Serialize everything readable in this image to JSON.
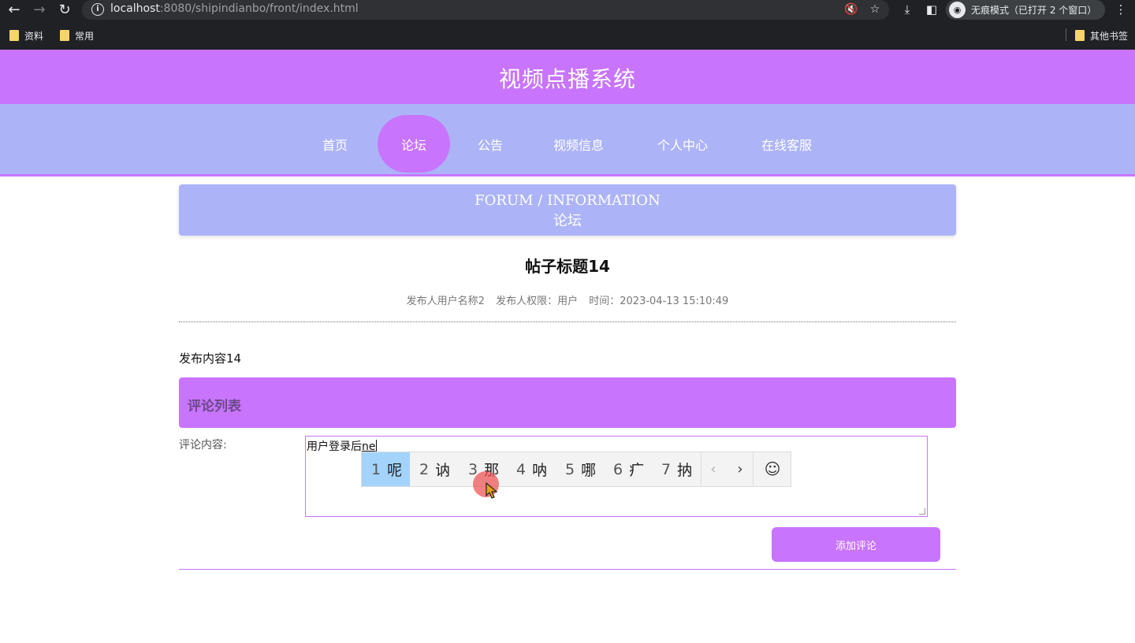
{
  "browser": {
    "url_host": "localhost",
    "url_rest": ":8080/shipindianbo/front/index.html",
    "incognito_label": "无痕模式（已打开 2 个窗口）",
    "bookmarks": [
      "资料",
      "常用"
    ],
    "other_bookmarks": "其他书签"
  },
  "site": {
    "title": "视频点播系统",
    "nav": [
      {
        "label": "首页"
      },
      {
        "label": "论坛",
        "active": true
      },
      {
        "label": "公告"
      },
      {
        "label": "视频信息"
      },
      {
        "label": "个人中心"
      },
      {
        "label": "在线客服"
      }
    ]
  },
  "banner": {
    "en": "FORUM / INFORMATION",
    "cn": "论坛"
  },
  "post": {
    "title": "帖子标题14",
    "author": "发布人用户名称2",
    "role": "发布人权限：用户",
    "time": "时间：2023-04-13 15:10:49",
    "content": "发布内容14"
  },
  "comments": {
    "header": "评论列表",
    "label": "评论内容:",
    "input_committed": "用户登录后",
    "input_preedit": "ne",
    "submit": "添加评论"
  },
  "ime": {
    "candidates": [
      {
        "num": "1",
        "char": "呢"
      },
      {
        "num": "2",
        "char": "讷"
      },
      {
        "num": "3",
        "char": "那"
      },
      {
        "num": "4",
        "char": "呐"
      },
      {
        "num": "5",
        "char": "哪"
      },
      {
        "num": "6",
        "char": "疒"
      },
      {
        "num": "7",
        "char": "抐"
      }
    ],
    "prev": "‹",
    "next": "›",
    "emoji": "☺"
  }
}
